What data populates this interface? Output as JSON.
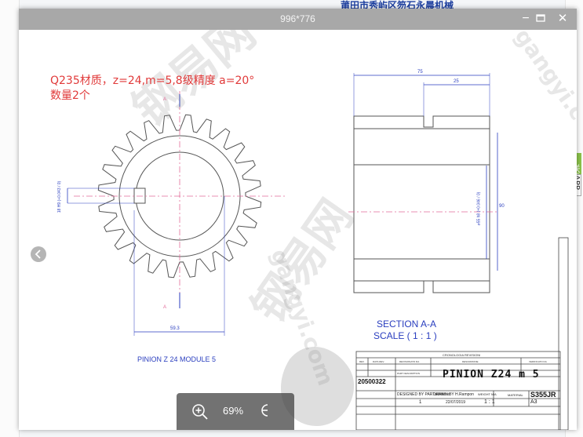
{
  "background": {
    "top_text": "莆田市秀屿区笏石永晨机械",
    "side_tab": "联系",
    "side_tab2": "APP"
  },
  "window": {
    "title": "996*776",
    "buttons": {
      "minimize": "−",
      "maximize": "□",
      "close": "✕"
    }
  },
  "note": {
    "line1": "Q235材质，z=24,m=5,8级精度 a=20°",
    "line2": "数量2个"
  },
  "drawing": {
    "gear_label": "PINION Z 24 MODULE 5",
    "section_title": "SECTION A-A",
    "section_scale": "SCALE ( 1 : 1 )",
    "dim_top_75": "75",
    "dim_top_25": "25",
    "dim_90": "90",
    "dim_bore": "⌀55 h8 (+0.046 / 0)",
    "dim_key": "18 H9 (+0.043 / 0)",
    "dim_bottom": "59.3",
    "section_marker": "A"
  },
  "title_block": {
    "header": "CRONOLOGIA REVISIONI",
    "col_rev": "REV",
    "col_date": "DATA REV.",
    "col_by": "REVISIONATO DA",
    "col_desc": "DESCRIZIONE",
    "col_check": "VERIFICATO DA",
    "part_label": "PART DESCRIPTION",
    "part_name": "PINION Z24 m 5",
    "drawing_no": "20500322",
    "designed_by": "DESIGNED BY PARTsolutions",
    "drawn_by": "DRAWN BY H.Rampon",
    "weight": "WEIGHT N/A",
    "material_label": "MATERIAL",
    "material": "S355JR",
    "sheet": "1",
    "date": "22/07/2019",
    "scale": "1 : 1",
    "format": "A3"
  },
  "zoom": {
    "level": "69%"
  },
  "watermarks": [
    "gangyi.com",
    "钢易网"
  ]
}
